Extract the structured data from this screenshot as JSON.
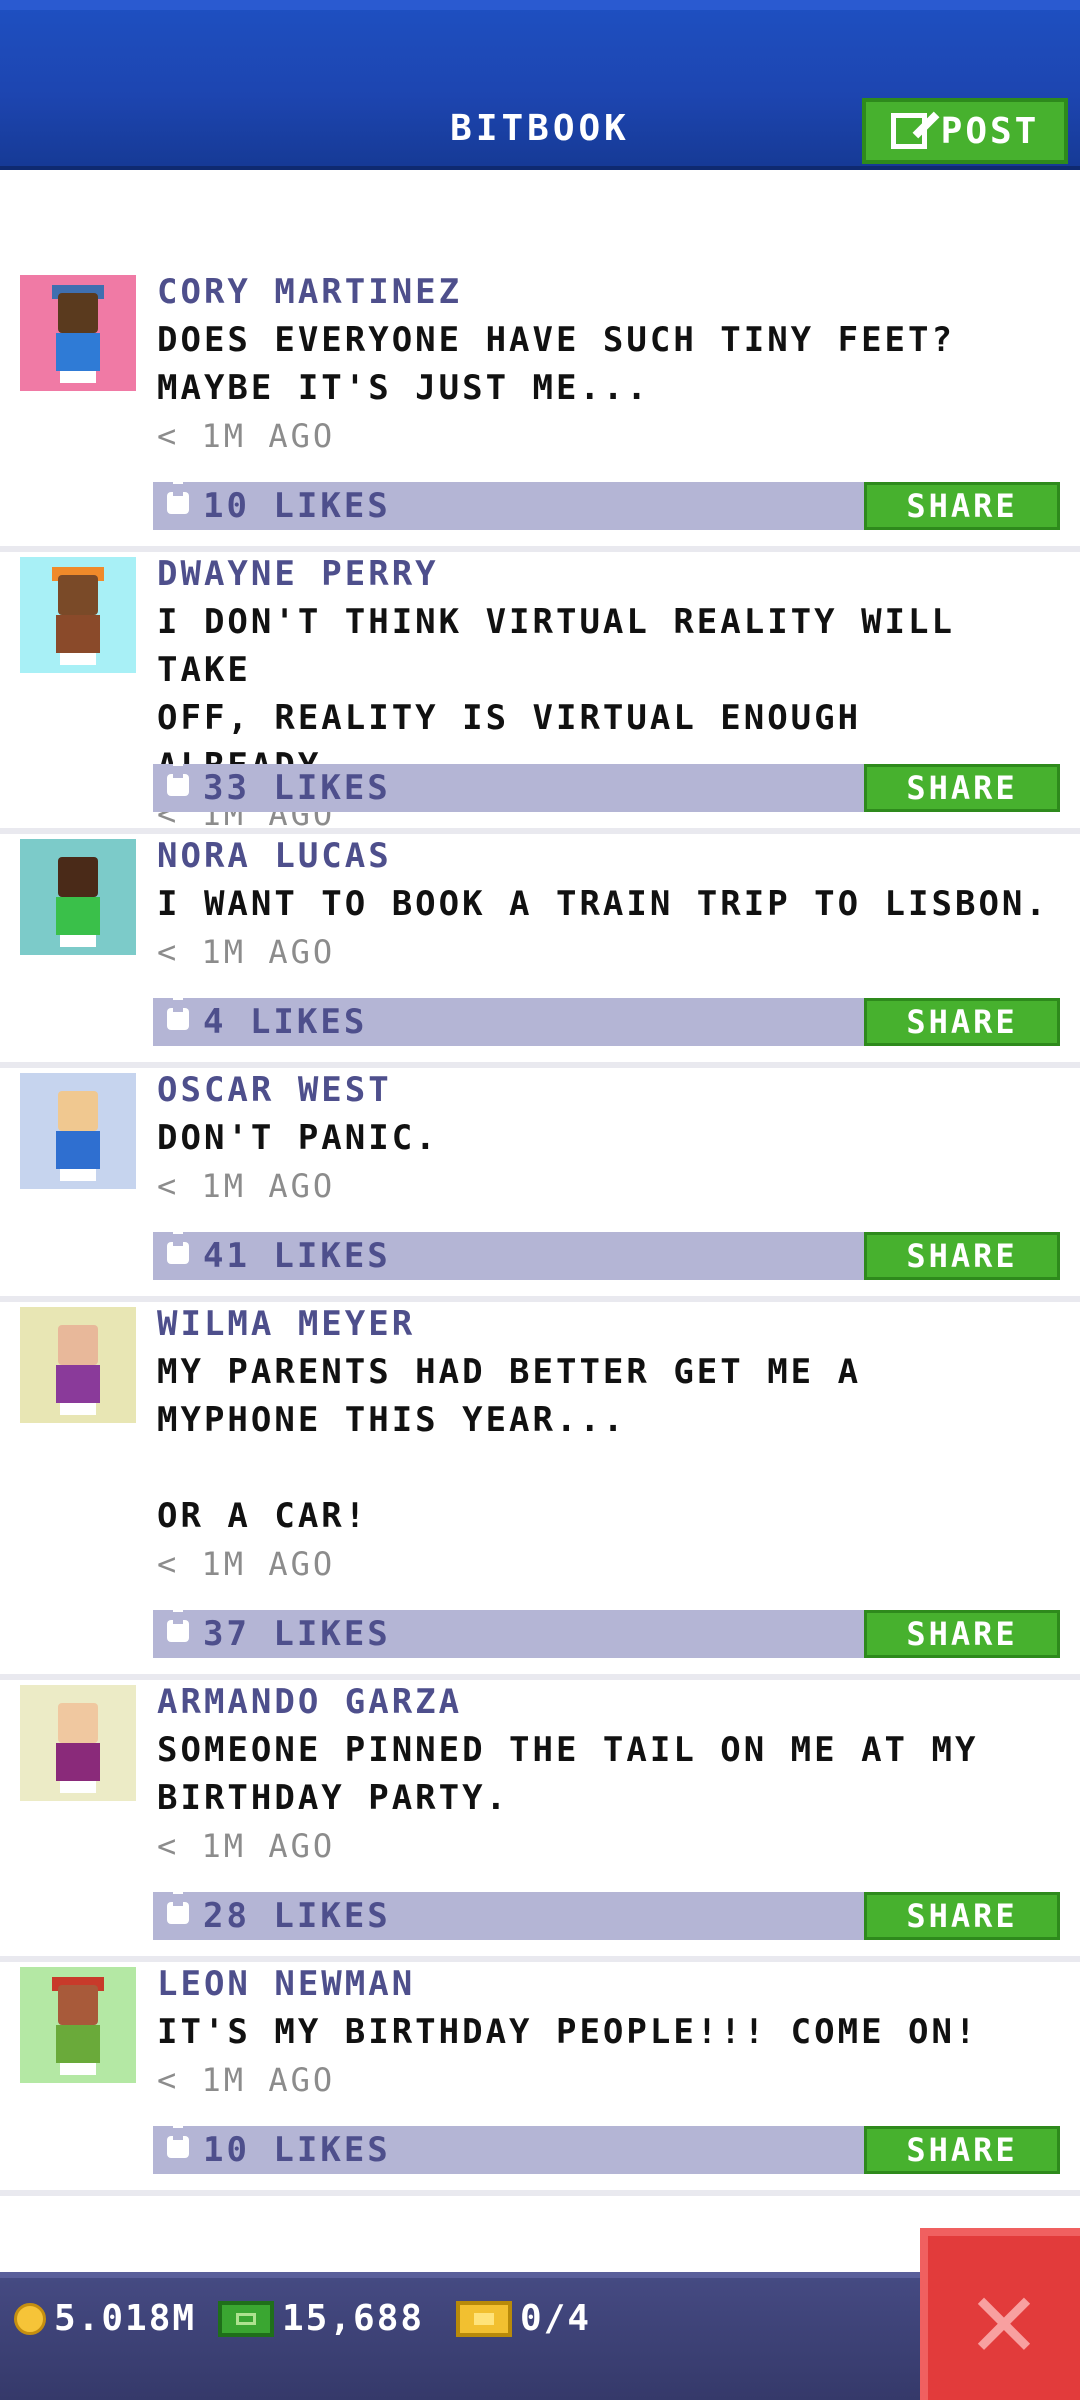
{
  "header": {
    "title": "BITBOOK",
    "post_label": "POST"
  },
  "posts": [
    {
      "name": "CORY MARTINEZ",
      "text": "DOES EVERYONE HAVE SUCH TINY FEET?\nMAYBE IT'S JUST ME...",
      "time": "< 1M AGO",
      "likes": "10 LIKES",
      "share": "SHARE",
      "avatar_bg": "#f07aa5",
      "skin": "#5a3a1e",
      "shirt": "#2f7bd6",
      "hat": "#3f6fb0"
    },
    {
      "name": "DWAYNE PERRY",
      "text": "I DON'T THINK VIRTUAL REALITY WILL TAKE\nOFF, REALITY IS VIRTUAL ENOUGH ALREADY.",
      "time": "< 1M AGO",
      "likes": "33 LIKES",
      "share": "SHARE",
      "avatar_bg": "#a8f0f6",
      "skin": "#7a4a28",
      "shirt": "#8a4a2a",
      "hat": "#f08a2a"
    },
    {
      "name": "NORA LUCAS",
      "text": "I WANT TO BOOK A TRAIN TRIP TO LISBON.",
      "time": "< 1M AGO",
      "likes": "4 LIKES",
      "share": "SHARE",
      "avatar_bg": "#7ccbc9",
      "skin": "#4a2a18",
      "shirt": "#3ac04a",
      "hat": ""
    },
    {
      "name": "OSCAR WEST",
      "text": "DON'T PANIC.",
      "time": "< 1M AGO",
      "likes": "41 LIKES",
      "share": "SHARE",
      "avatar_bg": "#c6d4ee",
      "skin": "#f0c890",
      "shirt": "#2f6fd0",
      "hat": ""
    },
    {
      "name": "WILMA MEYER",
      "text": "MY PARENTS HAD BETTER GET ME A\nMYPHONE THIS YEAR...\n\nOR A CAR!",
      "time": "< 1M AGO",
      "likes": "37 LIKES",
      "share": "SHARE",
      "avatar_bg": "#e8e6b4",
      "skin": "#e8b89a",
      "shirt": "#8a3a9a",
      "hat": ""
    },
    {
      "name": "ARMANDO GARZA",
      "text": "SOMEONE PINNED THE TAIL ON ME AT MY\nBIRTHDAY PARTY.",
      "time": "< 1M AGO",
      "likes": "28 LIKES",
      "share": "SHARE",
      "avatar_bg": "#ecebc6",
      "skin": "#f0c8a0",
      "shirt": "#8a2a7a",
      "hat": ""
    },
    {
      "name": "LEON NEWMAN",
      "text": "IT'S MY BIRTHDAY PEOPLE!!! COME ON!",
      "time": "< 1M AGO",
      "likes": "10 LIKES",
      "share": "SHARE",
      "avatar_bg": "#b4e8a4",
      "skin": "#a85a3a",
      "shirt": "#6aaa3a",
      "hat": "#c83a2a"
    }
  ],
  "footer": {
    "coins": "5.018M",
    "cash": "15,688",
    "tickets": "0/4"
  },
  "colors": {
    "header": "#1d45b0",
    "share_green": "#47b12e",
    "likes_bar": "#b4b5d5",
    "close_red": "#e23b3b"
  }
}
